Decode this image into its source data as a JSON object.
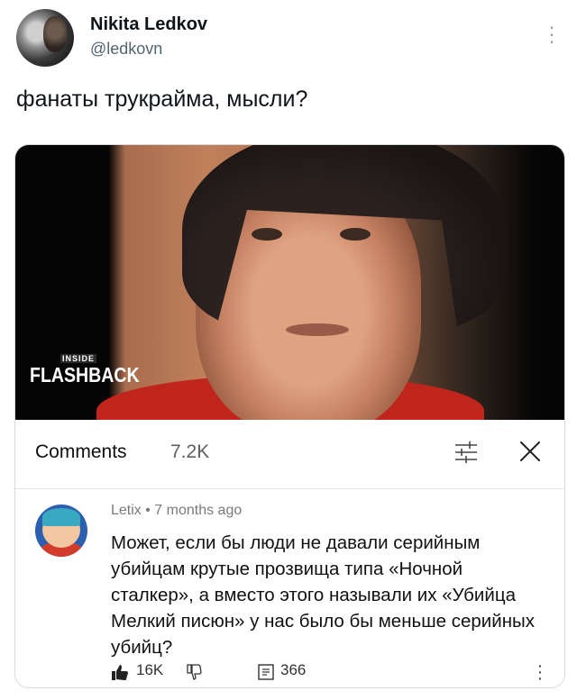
{
  "tweet": {
    "display_name": "Nikita Ledkov",
    "handle": "@ledkovn",
    "text": "фанаты трукрайма, мысли?"
  },
  "video": {
    "watermark_top": "INSIDE",
    "watermark_main": "FLASHBACK"
  },
  "comments_panel": {
    "title": "Comments",
    "count": "7.2K"
  },
  "comment": {
    "author": "Letix",
    "time": "7 months ago",
    "text": "Может, если бы люди не давали серийным убийцам крутые прозвища типа «Ночной сталкер», а вместо этого называли их «Убийца Мелкий писюн» у нас было бы меньше серийных убийц?",
    "likes": "16K",
    "replies": "366"
  },
  "icons": {
    "tweet_more": "more-vertical-icon",
    "filter": "filter-sliders-icon",
    "close": "close-icon",
    "like": "thumbs-up-icon",
    "dislike": "thumbs-down-icon",
    "reply": "reply-comment-icon",
    "comment_more": "more-vertical-icon"
  }
}
